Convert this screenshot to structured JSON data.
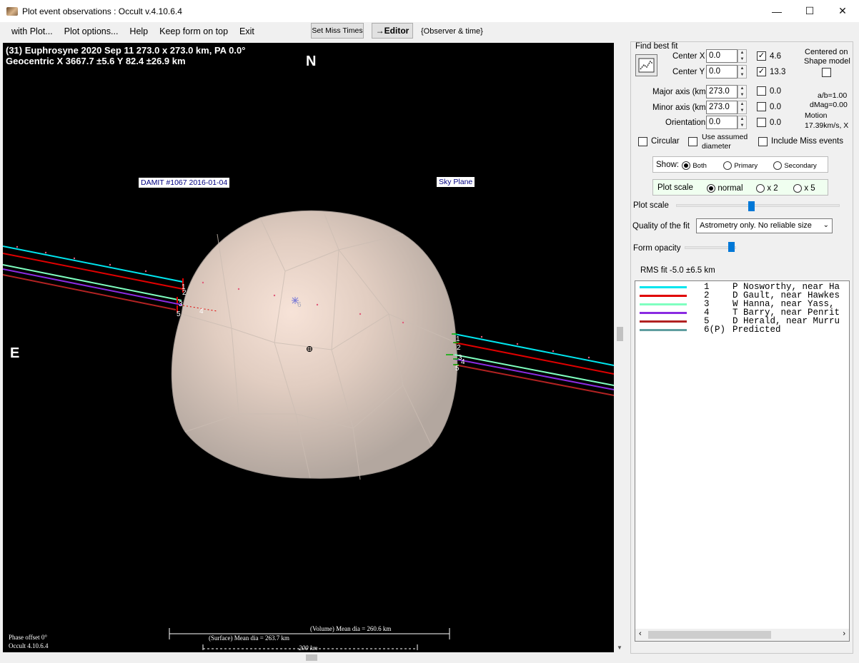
{
  "window": {
    "title": "Plot event observations : Occult v.4.10.6.4",
    "minimize": "—",
    "maximize": "☐",
    "close": "✕"
  },
  "menu": {
    "items": [
      "with Plot...",
      "Plot options...",
      "Help",
      "Keep form on top",
      "Exit"
    ]
  },
  "toolbar": {
    "set_miss_times": "Set Miss Times",
    "editor": "→Editor",
    "observer_time": "{Observer & time}"
  },
  "plot": {
    "header_line1": "(31) Euphrosyne  2020 Sep 11   273.0 x 273.0 km,  PA 0.0°",
    "header_line2": "Geocentric  X  3667.7 ±5.6  Y 82.4 ±26.9 km",
    "north_label": "N",
    "east_label": "E",
    "damit_label": "DAMIT #1067 2016-01-04",
    "sky_plane_label": "Sky Plane",
    "phase_offset": "Phase offset 0°",
    "version": "Occult 4.10.6.4",
    "volume_dia": "(Volume) Mean dia = 260.6 km",
    "surface_dia": "(Surface) Mean dia = 263.7 km",
    "scale_bar": "200 km",
    "chord_numbers": [
      "1",
      "2",
      "3",
      "4",
      "5",
      "6"
    ]
  },
  "fit": {
    "find_best_fit": "Find best fit",
    "center_x_label": "Center X",
    "center_x": "0.0",
    "center_x_check": "4.6",
    "center_y_label": "Center Y",
    "center_y": "0.0",
    "center_y_check": "13.3",
    "major_label": "Major axis (km)",
    "major": "273.0",
    "major_check": "0.0",
    "minor_label": "Minor axis (km)",
    "minor": "273.0",
    "minor_check": "0.0",
    "orient_label": "Orientation",
    "orient": "0.0",
    "orient_check": "0.0",
    "centered_on": "Centered on",
    "shape_model": "Shape model",
    "ab": "a/b=1.00",
    "dmag": "dMag=0.00",
    "motion": "Motion",
    "motion_val": "17.39km/s, X",
    "circular": "Circular",
    "use_assumed": "Use assumed",
    "diameter": "diameter",
    "include_miss": "Include Miss events"
  },
  "show": {
    "label": "Show:",
    "both": "Both",
    "primary": "Primary",
    "secondary": "Secondary"
  },
  "plot_scale_group": {
    "label": "Plot scale",
    "normal": "normal",
    "x2": "x 2",
    "x5": "x 5"
  },
  "sliders": {
    "plot_scale": "Plot scale",
    "opacity": "Form opacity"
  },
  "quality": {
    "label": "Quality of the fit",
    "value": "Astrometry only. No reliable size"
  },
  "rms": "RMS fit -5.0 ±6.5 km",
  "legend": [
    {
      "num": "1",
      "text": "P Nosworthy, near Ha",
      "color": "#00e5ee"
    },
    {
      "num": "2",
      "text": "D Gault, near Hawkes",
      "color": "#e00000"
    },
    {
      "num": "3",
      "text": "W Hanna, near Yass,",
      "color": "#7fffc0"
    },
    {
      "num": "4",
      "text": "T Barry, near Penrit",
      "color": "#8a2be2"
    },
    {
      "num": "5",
      "text": "D Herald, near Murru",
      "color": "#b22222"
    },
    {
      "num": "6(P)",
      "text": "Predicted",
      "color": "#5f9ea0"
    }
  ]
}
